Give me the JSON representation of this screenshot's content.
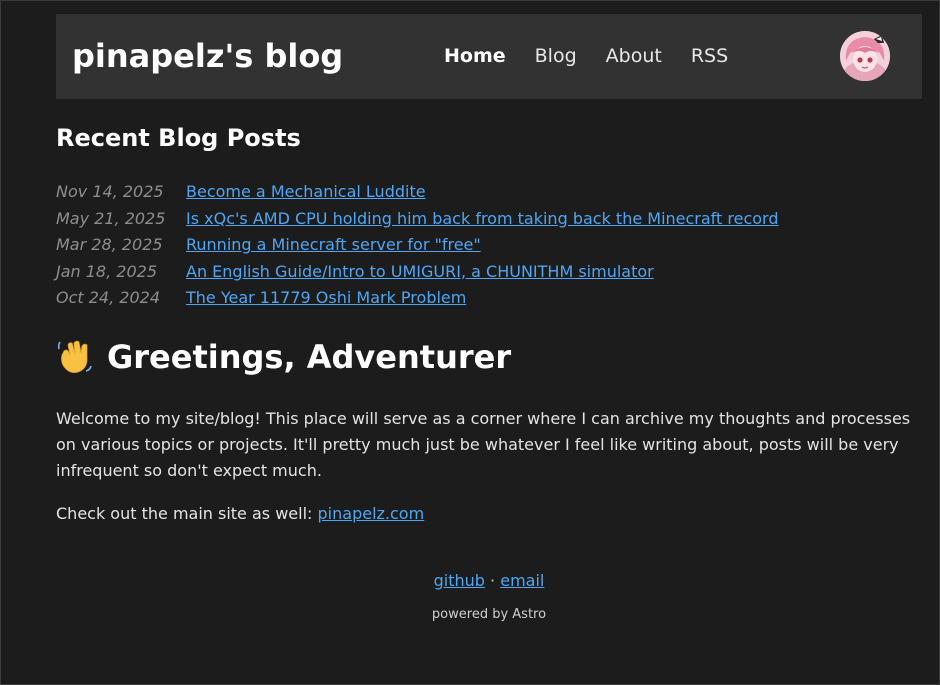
{
  "header": {
    "site_title": "pinapelz's blog",
    "nav": [
      {
        "label": "Home",
        "active": true
      },
      {
        "label": "Blog",
        "active": false
      },
      {
        "label": "About",
        "active": false
      },
      {
        "label": "RSS",
        "active": false
      }
    ]
  },
  "recent": {
    "heading": "Recent Blog Posts",
    "posts": [
      {
        "date": "Nov 14, 2025",
        "title": "Become a Mechanical Luddite"
      },
      {
        "date": "May 21, 2025",
        "title": "Is xQc's AMD CPU holding him back from taking back the Minecraft record"
      },
      {
        "date": "Mar 28, 2025",
        "title": "Running a Minecraft server for \"free\""
      },
      {
        "date": "Jan 18, 2025",
        "title": "An English Guide/Intro to UMIGURI, a CHUNITHM simulator"
      },
      {
        "date": "Oct 24, 2024",
        "title": "The Year 11779 Oshi Mark Problem"
      }
    ]
  },
  "greeting": {
    "icon": "waving-hand-icon",
    "title": "Greetings, Adventurer",
    "body": "Welcome to my site/blog! This place will serve as a corner where I can archive my thoughts and processes on various topics or projects. It'll pretty much just be whatever I feel like writing about, posts will be very infrequent so don't expect much.",
    "mainsite_prefix": "Check out the main site as well: ",
    "mainsite_link": "pinapelz.com"
  },
  "footer": {
    "github": "github",
    "separator": " · ",
    "email": "email",
    "powered": "powered by Astro"
  },
  "colors": {
    "background": "#1c1c1c",
    "header": "#323232",
    "link": "#4ea6f4",
    "date": "#8e8e8e"
  }
}
